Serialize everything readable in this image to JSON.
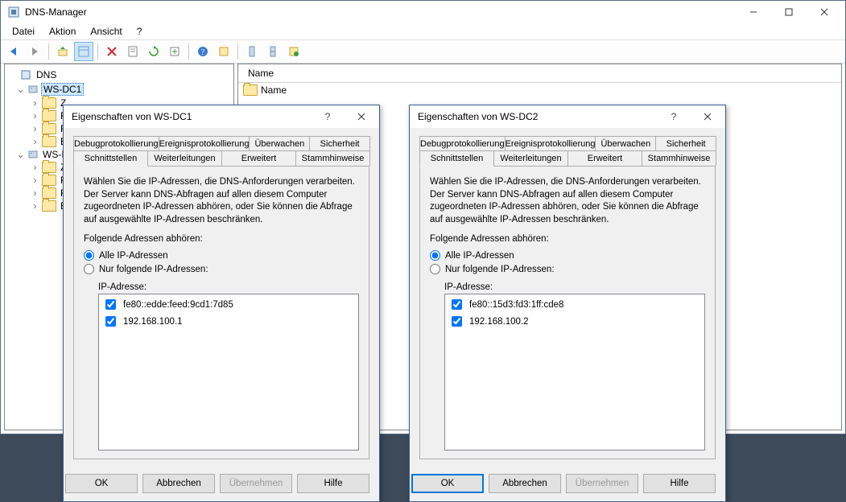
{
  "window": {
    "title": "DNS-Manager",
    "menus": [
      "Datei",
      "Aktion",
      "Ansicht",
      "?"
    ]
  },
  "tree": {
    "root": "DNS",
    "servers": [
      {
        "name": "WS-DC1",
        "selected": true,
        "children": [
          "Z",
          "F",
          "F",
          "E"
        ]
      },
      {
        "name": "WS-I",
        "selected": false,
        "children": [
          "Z",
          "F",
          "F",
          "E"
        ]
      }
    ]
  },
  "list": {
    "header": "Name",
    "rows": [
      "Name"
    ]
  },
  "dialogs": [
    {
      "title": "Eigenschaften von WS-DC1",
      "tabs_back": [
        "Debugprotokollierung",
        "Ereignisprotokollierung",
        "Überwachen",
        "Sicherheit"
      ],
      "tabs_front": [
        "Schnittstellen",
        "Weiterleitungen",
        "Erweitert",
        "Stammhinweise"
      ],
      "active_tab": "Schnittstellen",
      "description": "Wählen Sie die IP-Adressen, die DNS-Anforderungen verarbeiten. Der Server kann DNS-Abfragen auf allen diesem Computer zugeordneten IP-Adressen abhören, oder Sie können die Abfrage auf ausgewählte IP-Adressen beschränken.",
      "listen_label": "Folgende Adressen abhören:",
      "radio_all": "Alle IP-Adressen",
      "radio_sel": "Nur folgende IP-Adressen:",
      "radio_selected": "all",
      "ip_label": "IP-Adresse:",
      "ips": [
        "fe80::edde:feed:9cd1:7d85",
        "192.168.100.1"
      ],
      "buttons": {
        "ok": "OK",
        "cancel": "Abbrechen",
        "apply": "Übernehmen",
        "help": "Hilfe"
      },
      "default_btn": false
    },
    {
      "title": "Eigenschaften von WS-DC2",
      "tabs_back": [
        "Debugprotokollierung",
        "Ereignisprotokollierung",
        "Überwachen",
        "Sicherheit"
      ],
      "tabs_front": [
        "Schnittstellen",
        "Weiterleitungen",
        "Erweitert",
        "Stammhinweise"
      ],
      "active_tab": "Schnittstellen",
      "description": "Wählen Sie die IP-Adressen, die DNS-Anforderungen verarbeiten. Der Server kann DNS-Abfragen auf allen diesem Computer zugeordneten IP-Adressen abhören, oder Sie können die Abfrage auf ausgewählte IP-Adressen beschränken.",
      "listen_label": "Folgende Adressen abhören:",
      "radio_all": "Alle IP-Adressen",
      "radio_sel": "Nur folgende IP-Adressen:",
      "radio_selected": "all",
      "ip_label": "IP-Adresse:",
      "ips": [
        "fe80::15d3:fd3:1ff:cde8",
        "192.168.100.2"
      ],
      "buttons": {
        "ok": "OK",
        "cancel": "Abbrechen",
        "apply": "Übernehmen",
        "help": "Hilfe"
      },
      "default_btn": true
    }
  ]
}
